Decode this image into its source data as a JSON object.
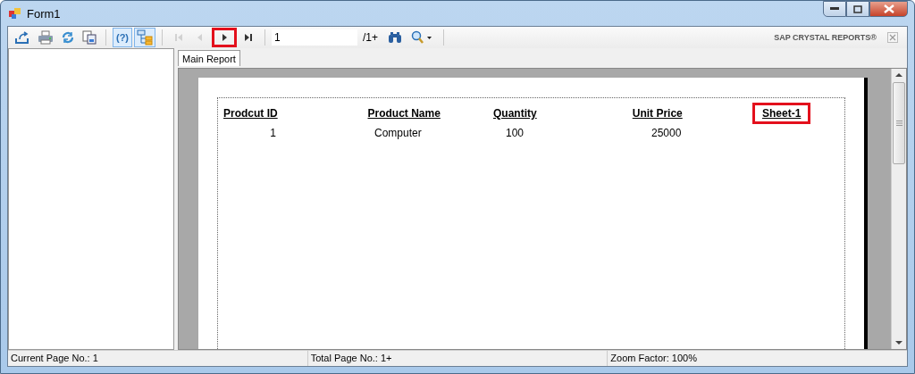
{
  "window": {
    "title": "Form1"
  },
  "toolbar": {
    "buttons": [
      {
        "kind": "export",
        "toggled": false,
        "disabled": false,
        "highlighted": false
      },
      {
        "kind": "print",
        "toggled": false,
        "disabled": false,
        "highlighted": false
      },
      {
        "kind": "refresh",
        "toggled": false,
        "disabled": false,
        "highlighted": false
      },
      {
        "kind": "copy",
        "toggled": false,
        "disabled": false,
        "highlighted": false
      },
      {
        "kind": "help",
        "label": "(?)",
        "toggled": true,
        "disabled": false,
        "highlighted": false
      },
      {
        "kind": "tree",
        "toggled": true,
        "disabled": false,
        "highlighted": false
      },
      {
        "kind": "first",
        "toggled": false,
        "disabled": true,
        "highlighted": false
      },
      {
        "kind": "prev",
        "toggled": false,
        "disabled": true,
        "highlighted": false
      },
      {
        "kind": "next",
        "toggled": false,
        "disabled": false,
        "highlighted": true
      },
      {
        "kind": "last",
        "toggled": false,
        "disabled": false,
        "highlighted": false
      }
    ],
    "page_field": {
      "value": "1"
    },
    "page_total": "/1+",
    "brand": "SAP CRYSTAL REPORTS®"
  },
  "tabs": [
    {
      "label": "Main Report",
      "selected": true
    }
  ],
  "report": {
    "columns": [
      {
        "label": "Prodcut ID",
        "highlighted": false
      },
      {
        "label": "Product Name",
        "highlighted": false
      },
      {
        "label": "Quantity",
        "highlighted": false
      },
      {
        "label": "Unit Price",
        "highlighted": false
      },
      {
        "label": "Sheet-1",
        "highlighted": true
      }
    ],
    "rows": [
      [
        "1",
        "Computer",
        "100",
        "25000"
      ]
    ]
  },
  "status_bar": [
    "Current Page No.: 1",
    "Total Page No.: 1+",
    "Zoom Factor: 100%"
  ]
}
